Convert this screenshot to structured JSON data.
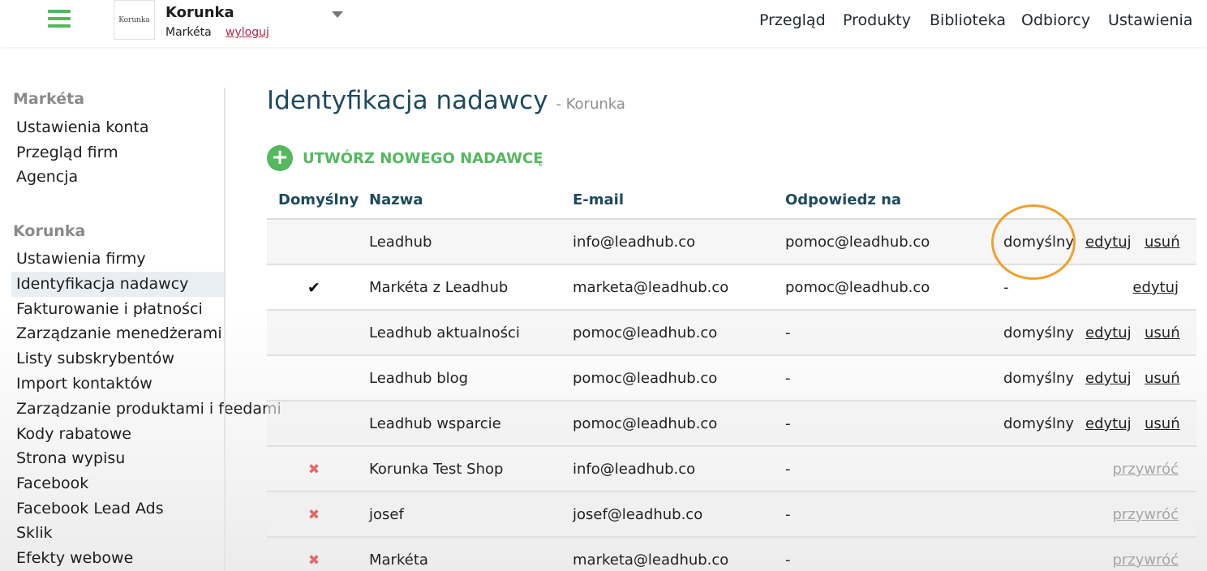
{
  "header": {
    "logo_text": "Korunka",
    "company": "Korunka",
    "user": "Markéta",
    "logout": "wyloguj",
    "nav": [
      "Przegląd",
      "Produkty",
      "Biblioteka",
      "Odbiorcy",
      "Ustawienia"
    ]
  },
  "sidebar": {
    "user_section": {
      "heading": "Markéta",
      "items": [
        "Ustawienia konta",
        "Przegląd firm",
        "Agencja"
      ]
    },
    "company_section": {
      "heading": "Korunka",
      "active_item": "Identyfikacja nadawcy",
      "items": [
        "Ustawienia firmy",
        "Identyfikacja nadawcy",
        "Fakturowanie i płatności",
        "Zarządzanie menedżerami",
        "Listy subskrybentów",
        "Import kontaktów",
        "Zarządzanie produktami i feedami",
        "Kody rabatowe",
        "Strona wypisu",
        "Facebook",
        "Facebook Lead Ads",
        "Sklik",
        "Efekty webowe"
      ]
    }
  },
  "main": {
    "title": "Identyfikacja nadawcy",
    "subtitle": "- Korunka",
    "create_button": "UTWÓRZ NOWEGO NADAWCĘ",
    "columns": [
      "Domyślny",
      "Nazwa",
      "E-mail",
      "Odpowiedz na"
    ],
    "rows": [
      {
        "status": "",
        "name": "Leadhub",
        "email": "info@leadhub.co",
        "reply": "pomoc@leadhub.co",
        "default_label": "domyślny",
        "edit": "edytuj",
        "delete": "usuń"
      },
      {
        "status": "default",
        "name": "Markéta z Leadhub",
        "email": "marketa@leadhub.co",
        "reply": "pomoc@leadhub.co",
        "dash": "-",
        "edit": "edytuj"
      },
      {
        "status": "",
        "name": "Leadhub aktualności",
        "email": "pomoc@leadhub.co",
        "reply": "-",
        "default_label": "domyślny",
        "edit": "edytuj",
        "delete": "usuń"
      },
      {
        "status": "",
        "name": "Leadhub blog",
        "email": "pomoc@leadhub.co",
        "reply": "-",
        "default_label": "domyślny",
        "edit": "edytuj",
        "delete": "usuń"
      },
      {
        "status": "",
        "name": "Leadhub wsparcie",
        "email": "pomoc@leadhub.co",
        "reply": "-",
        "default_label": "domyślny",
        "edit": "edytuj",
        "delete": "usuń"
      },
      {
        "status": "deleted",
        "name": "Korunka Test Shop",
        "email": "info@leadhub.co",
        "reply": "-",
        "restore": "przywróć"
      },
      {
        "status": "deleted",
        "name": "josef",
        "email": "josef@leadhub.co",
        "reply": "-",
        "restore": "przywróć"
      },
      {
        "status": "deleted",
        "name": "Markéta",
        "email": "marketa@leadhub.co",
        "reply": "-",
        "restore": "przywróć"
      }
    ],
    "glyphs": {
      "check": "✔",
      "cross": "✖",
      "plus": "+"
    }
  },
  "colors": {
    "accent_green": "#55b85f",
    "heading_blue": "#1e4a5e",
    "logout_red": "#b0284e",
    "deleted_red": "#e26a6a",
    "highlight_orange": "#f0a030"
  }
}
